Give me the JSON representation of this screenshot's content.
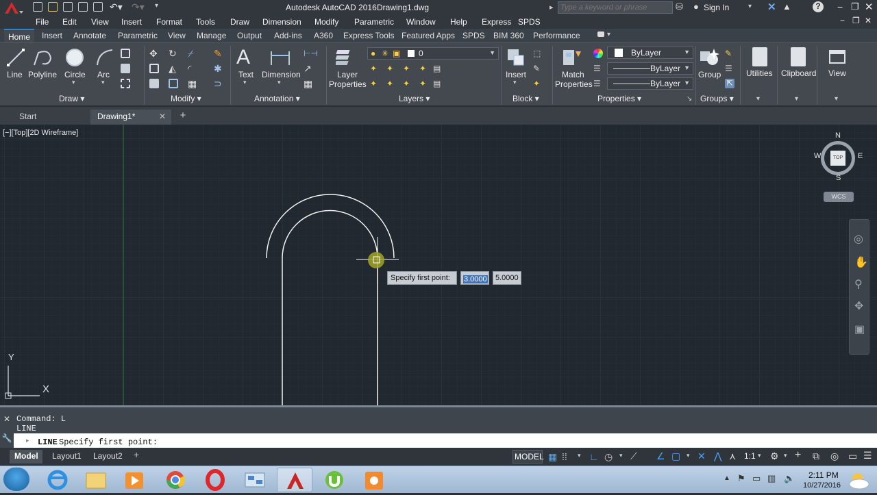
{
  "titlebar": {
    "app_title": "Autodesk AutoCAD 2016",
    "doc_title": "Drawing1.dwg",
    "search_placeholder": "Type a keyword or phrase",
    "sign_in": "Sign In"
  },
  "menubar": {
    "items": [
      "File",
      "Edit",
      "View",
      "Insert",
      "Format",
      "Tools",
      "Draw",
      "Dimension",
      "Modify",
      "Parametric",
      "Window",
      "Help",
      "Express",
      "SPDS"
    ]
  },
  "ribbon_tabs": [
    "Home",
    "Insert",
    "Annotate",
    "Parametric",
    "View",
    "Manage",
    "Output",
    "Add-ins",
    "A360",
    "Express Tools",
    "Featured Apps",
    "SPDS",
    "BIM 360",
    "Performance"
  ],
  "ribbon": {
    "draw": {
      "line": "Line",
      "polyline": "Polyline",
      "circle": "Circle",
      "arc": "Arc",
      "title": "Draw"
    },
    "modify": {
      "title": "Modify"
    },
    "annotation": {
      "text": "Text",
      "dimension": "Dimension",
      "title": "Annotation"
    },
    "layers": {
      "layer_properties_1": "Layer",
      "layer_properties_2": "Properties",
      "current_layer": "0",
      "title": "Layers"
    },
    "block": {
      "insert": "Insert",
      "title": "Block"
    },
    "properties": {
      "match_1": "Match",
      "match_2": "Properties",
      "color": "ByLayer",
      "linetype": "ByLayer",
      "lineweight": "ByLayer",
      "title": "Properties"
    },
    "groups": {
      "group": "Group",
      "title": "Groups"
    },
    "utilities": "Utilities",
    "clipboard": "Clipboard",
    "view": "View"
  },
  "doc_tabs": {
    "start": "Start",
    "drawing": "Drawing1*"
  },
  "viewport": {
    "label": "[−][Top][2D Wireframe]",
    "viewcube": {
      "n": "N",
      "s": "S",
      "e": "E",
      "w": "W",
      "top": "TOP",
      "wcs": "WCS"
    },
    "ucs": {
      "x": "X",
      "y": "Y"
    },
    "tooltip": {
      "prompt": "Specify first point:",
      "x_value": "3.0000",
      "y_value": "5.0000"
    }
  },
  "command": {
    "history_1": "Command: L",
    "history_2": "LINE",
    "prompt_cmd": "LINE",
    "prompt_text": "Specify first point:"
  },
  "status": {
    "model_tab": "Model",
    "layout1": "Layout1",
    "layout2": "Layout2",
    "model_button": "MODEL",
    "scale": "1:1"
  },
  "taskbar": {
    "time": "2:11 PM",
    "date": "10/27/2016"
  }
}
